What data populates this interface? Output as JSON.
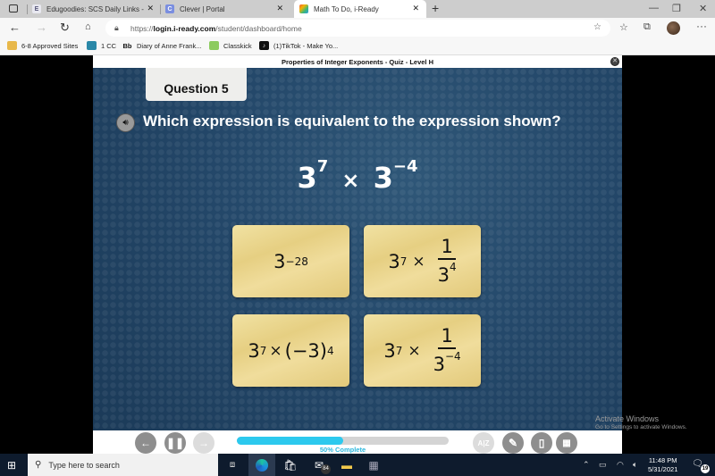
{
  "browser": {
    "tabs": [
      {
        "label": "Edugoodies: SCS Daily Links - ec",
        "icon": "edugoodies-favicon",
        "active": false
      },
      {
        "label": "Clever | Portal",
        "icon": "clever-favicon",
        "active": false
      },
      {
        "label": "Math To Do, i-Ready",
        "icon": "iready-favicon",
        "active": true
      }
    ],
    "new_tab_label": "+",
    "url_prefix": "https://",
    "url_domain": "login.i-ready.com",
    "url_path": "/student/dashboard/home",
    "bookmarks": [
      {
        "label": "6-8 Approved Sites",
        "icon": "folder-icon"
      },
      {
        "label": "1 CC",
        "icon": "teams-icon"
      },
      {
        "label": "Diary of Anne Frank...",
        "icon": "blackboard-icon",
        "icon_text": "Bb"
      },
      {
        "label": "Classkick",
        "icon": "classkick-icon"
      },
      {
        "label": "(1)TikTok - Make Yo...",
        "icon": "tiktok-icon"
      }
    ]
  },
  "quiz": {
    "title": "Properties of Integer Exponents - Quiz - Level H",
    "question_label": "Question 5",
    "prompt": "Which expression is equivalent to the expression shown?",
    "expression": {
      "base1": "3",
      "exp1": "7",
      "op": "×",
      "base2": "3",
      "exp2": "−4"
    },
    "choices": [
      {
        "base": "3",
        "exp": "−28"
      },
      {
        "base": "3",
        "exp": "7",
        "op": "×",
        "num": "1",
        "den_base": "3",
        "den_exp": "4"
      },
      {
        "base": "3",
        "exp": "7",
        "op": "×",
        "paren": "(−3)",
        "paren_exp": "4"
      },
      {
        "base": "3",
        "exp": "7",
        "op": "×",
        "num": "1",
        "den_base": "3",
        "den_exp": "−4"
      }
    ],
    "progress_percent": 50,
    "progress_label": "50% Complete",
    "controls": {
      "back": "back-arrow",
      "pause": "pause",
      "forward": "forward-arrow",
      "glossary": "glossary",
      "pencil": "pencil",
      "notepad": "notepad",
      "calculator": "calculator"
    }
  },
  "watermark": {
    "line1": "Activate Windows",
    "line2": "Go to Settings to activate Windows."
  },
  "taskbar": {
    "search_placeholder": "Type here to search",
    "mail_badge": "84",
    "time": "11:48 PM",
    "date": "5/31/2021",
    "notification_count": "19"
  }
}
